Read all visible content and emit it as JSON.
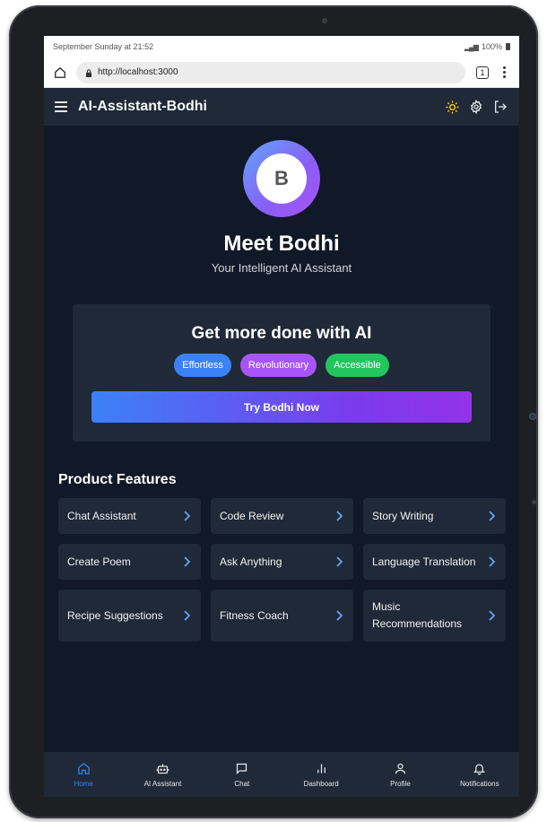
{
  "statusbar": {
    "time_text": "September Sunday at 21:52",
    "battery": "100%"
  },
  "browser": {
    "url": "http://localhost:3000",
    "tab_count": "1"
  },
  "header": {
    "title": "AI-Assistant-Bodhi"
  },
  "hero": {
    "avatar_letter": "B",
    "title": "Meet Bodhi",
    "subtitle": "Your Intelligent AI Assistant"
  },
  "promo": {
    "title": "Get more done with AI",
    "pills": [
      "Effortless",
      "Revolutionary",
      "Accessible"
    ],
    "cta_label": "Try Bodhi Now"
  },
  "features": {
    "title": "Product Features",
    "items": [
      "Chat Assistant",
      "Code Review",
      "Story Writing",
      "Create Poem",
      "Ask Anything",
      "Language Translation",
      "Recipe Suggestions",
      "Fitness Coach",
      "Music Recommendations"
    ]
  },
  "nav": {
    "items": [
      {
        "label": "Home",
        "icon": "home-icon",
        "active": true
      },
      {
        "label": "AI Assistant",
        "icon": "robot-icon"
      },
      {
        "label": "Chat",
        "icon": "chat-icon"
      },
      {
        "label": "Dashboard",
        "icon": "bar-chart-icon"
      },
      {
        "label": "Profile",
        "icon": "user-icon"
      },
      {
        "label": "Notifications",
        "icon": "bell-icon"
      }
    ]
  },
  "colors": {
    "accent": "#3b82f6",
    "purple": "#a855f7",
    "green": "#22c55e",
    "background": "#111827",
    "surface": "#1f2937",
    "sun": "#facc15"
  }
}
